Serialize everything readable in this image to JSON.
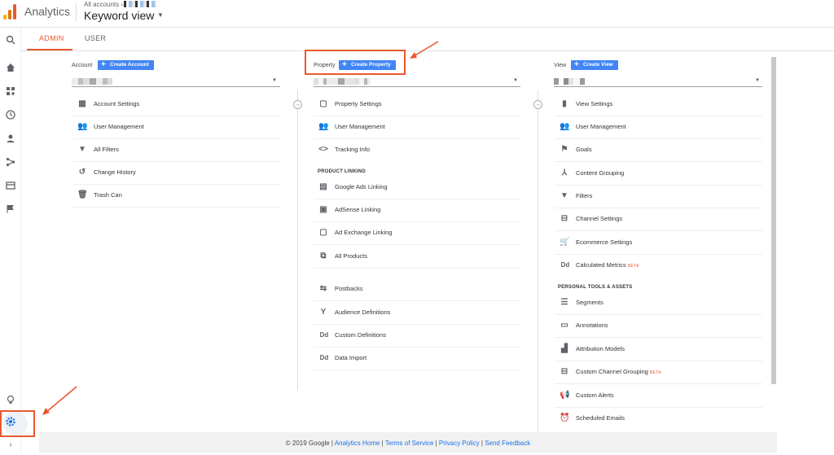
{
  "topbar": {
    "app_name": "Analytics",
    "all_accounts": "All accounts",
    "view_name": "Keyword view",
    "logo_colors": [
      "#f9ab00",
      "#e37400",
      "#e8592f"
    ]
  },
  "rail": {
    "icons": [
      "search-icon",
      "home-icon",
      "dashboard-icon",
      "clock-icon",
      "person-icon",
      "acquisition-icon",
      "behavior-icon",
      "flag-icon",
      "lightbulb-icon",
      "gear-icon",
      "expand-icon"
    ]
  },
  "tabs": {
    "admin": "ADMIN",
    "user": "USER"
  },
  "account": {
    "label": "Account",
    "create": "Create Account",
    "items": [
      {
        "label": "Account Settings"
      },
      {
        "label": "User Management"
      },
      {
        "label": "All Filters"
      },
      {
        "label": "Change History"
      },
      {
        "label": "Trash Can"
      }
    ]
  },
  "property": {
    "label": "Property",
    "create": "Create Property",
    "items": [
      {
        "label": "Property Settings"
      },
      {
        "label": "User Management"
      },
      {
        "label": "Tracking Info"
      }
    ],
    "section": "PRODUCT LINKING",
    "linking": [
      {
        "label": "Google Ads Linking"
      },
      {
        "label": "AdSense Linking"
      },
      {
        "label": "Ad Exchange Linking"
      },
      {
        "label": "All Products"
      }
    ],
    "more": [
      {
        "label": "Postbacks"
      },
      {
        "label": "Audience Definitions"
      },
      {
        "label": "Custom Definitions"
      },
      {
        "label": "Data Import"
      }
    ]
  },
  "view": {
    "label": "View",
    "create": "Create View",
    "items": [
      {
        "label": "View Settings"
      },
      {
        "label": "User Management"
      },
      {
        "label": "Goals"
      },
      {
        "label": "Content Grouping"
      },
      {
        "label": "Filters"
      },
      {
        "label": "Channel Settings"
      },
      {
        "label": "Ecommerce Settings"
      },
      {
        "label": "Calculated Metrics",
        "badge": "BETA"
      }
    ],
    "section": "PERSONAL TOOLS & ASSETS",
    "tools": [
      {
        "label": "Segments"
      },
      {
        "label": "Annotations"
      },
      {
        "label": "Attribution Models"
      },
      {
        "label": "Custom Channel Grouping",
        "badge": "BETA"
      },
      {
        "label": "Custom Alerts"
      },
      {
        "label": "Scheduled Emails"
      }
    ]
  },
  "footer": {
    "copyright": "© 2019 Google",
    "links": [
      "Analytics Home",
      "Terms of Service",
      "Privacy Policy",
      "Send Feedback"
    ]
  },
  "colors": {
    "accent": "#e8592f",
    "button": "#4285f4",
    "link": "#1a73e8"
  }
}
